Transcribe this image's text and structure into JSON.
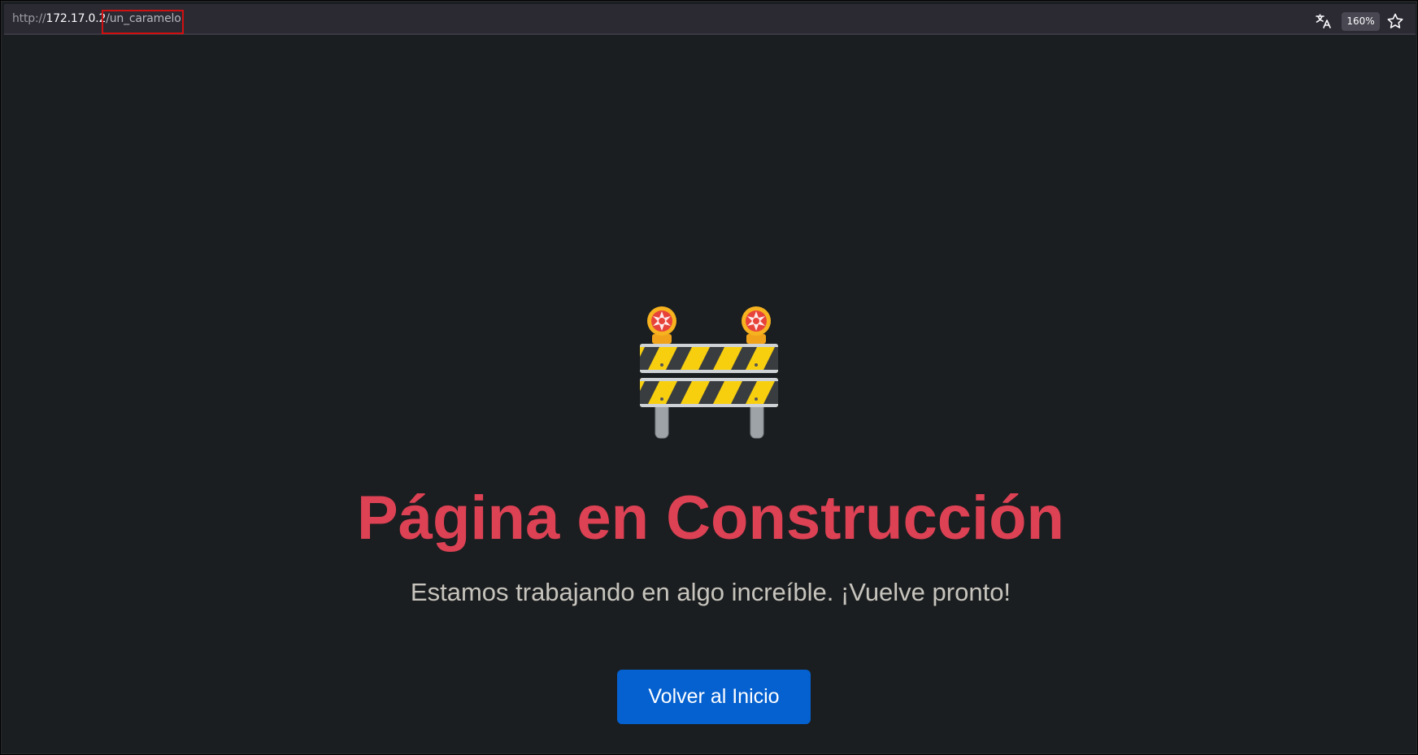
{
  "browser": {
    "url_scheme": "http://",
    "url_host": "172.17.0.2",
    "url_path": "/un_caramelo",
    "zoom": "160%",
    "icons": [
      "translate-icon",
      "bookmark-star-icon"
    ]
  },
  "page": {
    "title": "Página en Construcción",
    "subtitle": "Estamos trabajando en algo increíble. ¡Vuelve pronto!",
    "button_label": "Volver al Inicio",
    "illustration": "construction-barrier-icon"
  },
  "colors": {
    "page_background": "#1b1e20",
    "title": "#dc4154",
    "subtitle": "#c7c4bd",
    "button": "#0561d0",
    "highlight_box": "#d01010"
  }
}
